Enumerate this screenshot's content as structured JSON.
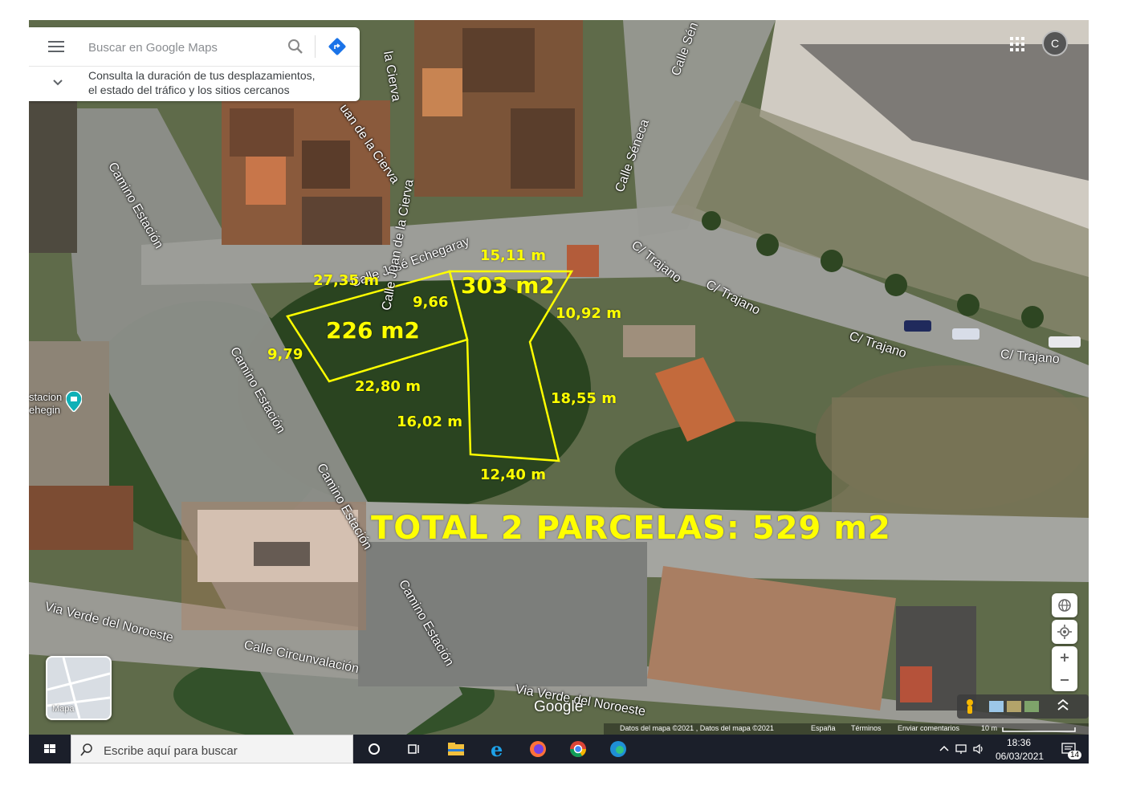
{
  "search": {
    "placeholder": "Buscar en Google Maps",
    "hint_line1": "Consulta la duración de tus desplazamientos,",
    "hint_line2": "el estado del tráfico y los sitios cercanos"
  },
  "header": {
    "avatar_initial": "C"
  },
  "annotations": {
    "m_27_35": "27,35 m",
    "m_15_11": "15,11 m",
    "m_9_66": "9,66",
    "area_303": "303 m2",
    "area_226": "226 m2",
    "m_10_92": "10,92 m",
    "m_9_79": "9,79",
    "m_22_80": "22,80 m",
    "m_18_55": "18,55 m",
    "m_16_02": "16,02 m",
    "m_12_40": "12,40 m",
    "total": "TOTAL 2 PARCELAS: 529 m2"
  },
  "streets": {
    "calle_jose_echegaray": "Calle José Echegaray",
    "calle_juan_de_la_cierva": "Calle Juan de la Cierva",
    "juan_de_la_cierva": "uan de la Cierva",
    "la_cierva": "la Cierva",
    "calle_seneca": "Calle Séneca",
    "calle_sen": "Calle Sén",
    "trajano": "C/ Trajano",
    "camino_estacion": "Camino Estación",
    "via_verde": "Via Verde del Noroeste",
    "calle_circunvalacion": "Calle Circunvalación",
    "poi_line1": "stacion",
    "poi_line2": "ehegin"
  },
  "map_controls": {
    "mapa_label": "Mapa",
    "google": "Google",
    "attribution": "Datos del mapa ©2021 , Datos del mapa ©2021",
    "country": "España",
    "terms": "Términos",
    "feedback": "Enviar comentarios",
    "scale": "10 m"
  },
  "taskbar": {
    "search_placeholder": "Escribe aquí para buscar",
    "time": "18:36",
    "date": "06/03/2021",
    "notifications": "14"
  },
  "colors": {
    "annotation": "#ffff00",
    "taskbar": "#1b1f2a",
    "maps_blue": "#4285f4"
  }
}
